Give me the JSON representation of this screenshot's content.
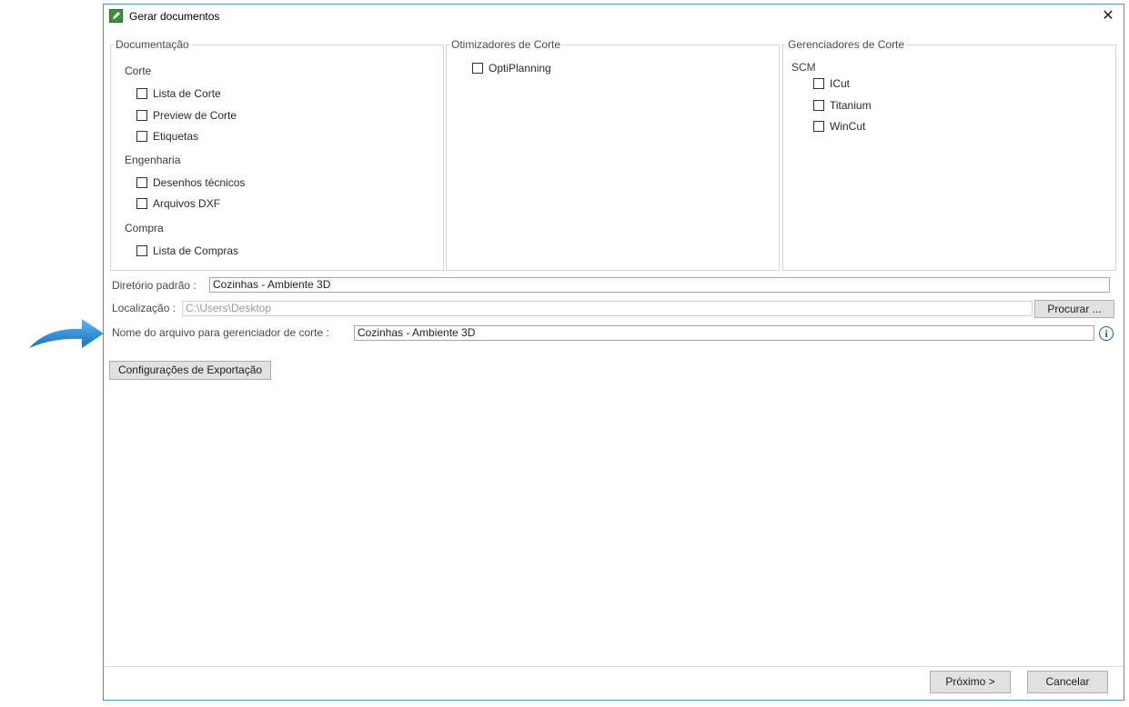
{
  "window": {
    "title": "Gerar documentos",
    "close_glyph": "✕"
  },
  "groups": {
    "documentacao": {
      "legend": "Documentação",
      "sections": [
        {
          "label": "Corte",
          "items": [
            "Lista de Corte",
            "Preview de Corte",
            "Etiquetas"
          ]
        },
        {
          "label": "Engenharia",
          "items": [
            "Desenhos técnicos",
            "Arquivos DXF"
          ]
        },
        {
          "label": "Compra",
          "items": [
            "Lista de Compras"
          ]
        }
      ]
    },
    "otimizadores": {
      "legend": "Otimizadores de Corte",
      "items": [
        "OptiPlanning"
      ]
    },
    "gerenciadores": {
      "legend": "Gerenciadores de Corte",
      "section": "SCM",
      "items": [
        "ICut",
        "Titanium",
        "WinCut"
      ]
    }
  },
  "fields": {
    "diretorio": {
      "label": "Diretório padrão :",
      "value": "Cozinhas - Ambiente 3D"
    },
    "localizacao": {
      "label": "Localização :",
      "value": "C:\\Users\\Desktop",
      "button": "Procurar ..."
    },
    "nome_arquivo": {
      "label": "Nome do arquivo para gerenciador de corte :",
      "value": "Cozinhas - Ambiente 3D",
      "info_glyph": "i"
    }
  },
  "export_button": "Configurações de Exportação",
  "footer": {
    "next": "Próximo >",
    "cancel": "Cancelar"
  },
  "icons": {
    "app": "edit-document-icon",
    "info": "info-icon",
    "arrow": "blue-arrow-icon"
  },
  "colors": {
    "accent": "#1e88d6",
    "window_border": "#5b8ed0"
  }
}
